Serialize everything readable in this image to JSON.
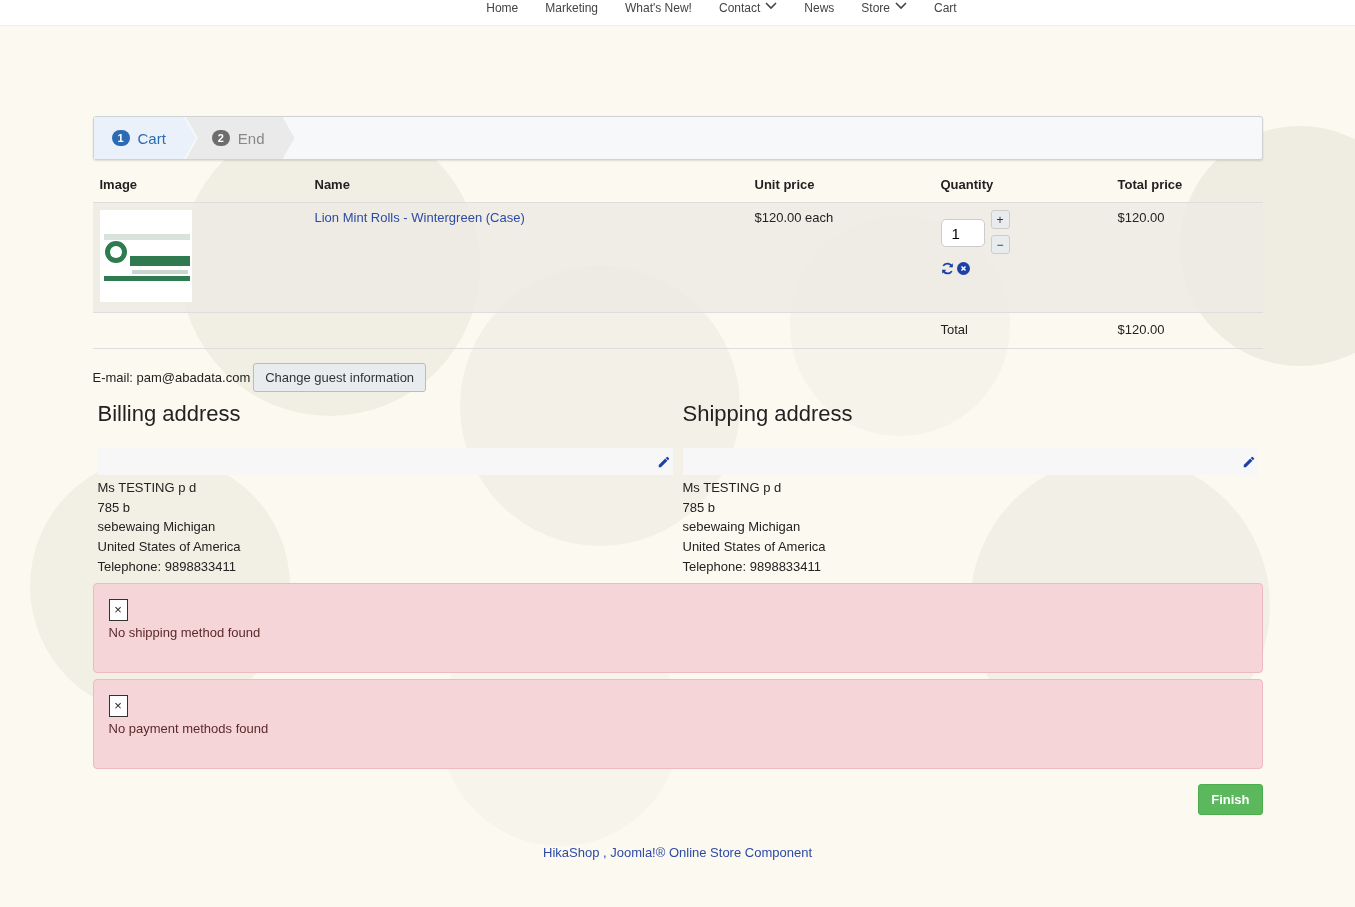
{
  "nav": [
    {
      "label": "Home",
      "dropdown": false
    },
    {
      "label": "Marketing",
      "dropdown": false
    },
    {
      "label": "What's New!",
      "dropdown": false
    },
    {
      "label": "Contact",
      "dropdown": true
    },
    {
      "label": "News",
      "dropdown": false
    },
    {
      "label": "Store",
      "dropdown": true
    },
    {
      "label": "Cart",
      "dropdown": false
    }
  ],
  "steps": [
    {
      "number": "1",
      "label": "Cart",
      "selected": true
    },
    {
      "number": "2",
      "label": "End",
      "selected": false
    }
  ],
  "cart": {
    "columns": [
      "Image",
      "Name",
      "Unit price",
      "Quantity",
      "Total price"
    ],
    "rows": [
      {
        "name": "Lion Mint Rolls - Wintergreen (Case)",
        "unit_price": "$120.00 each",
        "quantity": "1",
        "plus": "+",
        "minus": "−",
        "total": "$120.00"
      }
    ],
    "total_label": "Total",
    "total": "$120.00"
  },
  "guest": {
    "email": "E-mail: pam@abadata.com",
    "button": "Change guest information"
  },
  "addresses": [
    {
      "title": "Billing address",
      "lines": [
        "Ms TESTING p d",
        "785 b",
        "sebewaing Michigan",
        "United States of America",
        "Telephone: 9898833411"
      ]
    },
    {
      "title": "Shipping address",
      "lines": [
        "Ms TESTING p d",
        "785 b",
        "sebewaing Michigan",
        "United States of America",
        "Telephone: 9898833411"
      ]
    }
  ],
  "alerts": [
    {
      "close": "×",
      "message": "No shipping method found"
    },
    {
      "close": "×",
      "message": "No payment methods found"
    }
  ],
  "finish_button": "Finish",
  "footer_link": "HikaShop , Joomla!® Online Store Component"
}
